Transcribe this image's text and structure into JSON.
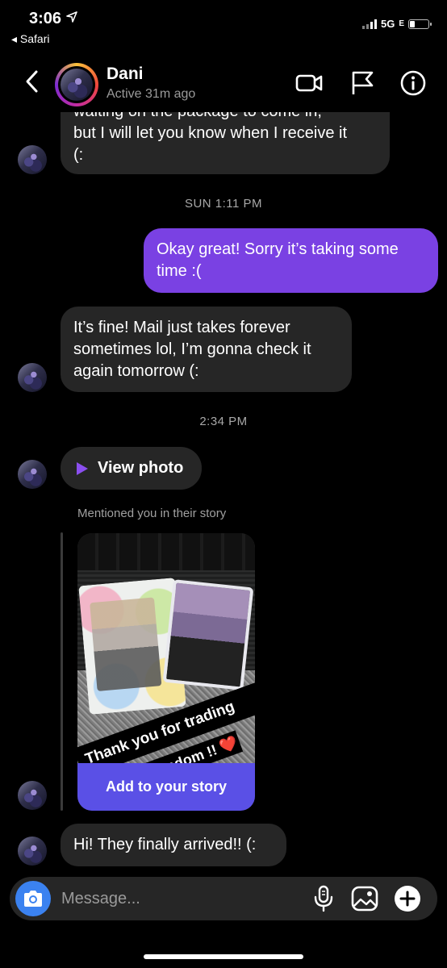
{
  "status_bar": {
    "time": "3:06",
    "back_app": "◂ Safari",
    "network": "5G",
    "network_suffix": "E"
  },
  "header": {
    "name": "Dani",
    "status": "Active 31m ago"
  },
  "messages": {
    "m1_line1": "waiting on the package to come in,",
    "m1_line2": "but I will let you know when I receive it",
    "m1_line3": "(:",
    "stamp1": "SUN 1:11 PM",
    "m2_line1": "Okay great! Sorry it’s taking some",
    "m2_line2": "time :(",
    "m3_line1": "It’s fine! Mail just takes forever",
    "m3_line2": "sometimes lol, I’m gonna check it",
    "m3_line3": "again tomorrow (:",
    "stamp2": "2:34 PM",
    "view_photo": "View photo",
    "mention_label": "Mentioned you in their story",
    "story_sticker_1": "Thank you for trading",
    "story_sticker_2": "fandom !! ❤️",
    "add_to_story": "Add to your story",
    "m4": "Hi! They finally arrived!! (:"
  },
  "composer": {
    "placeholder": "Message..."
  },
  "colors": {
    "outgoing_bubble": "#7a41e3",
    "incoming_bubble": "#262626",
    "story_button": "#5a50e6",
    "camera_button": "#3b82f0"
  }
}
